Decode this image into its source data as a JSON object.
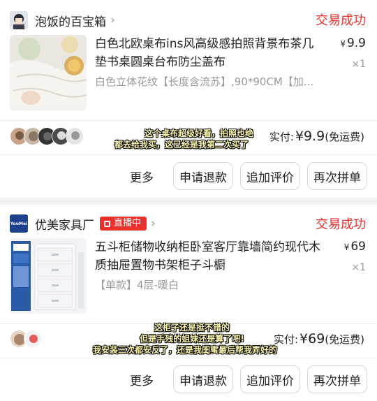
{
  "orders": [
    {
      "shop_name": "泡饭的百宝箱",
      "status": "交易成功",
      "title": "白色北欧桌布ins风高级感拍照背景布茶几垫书桌圆桌台布防尘盖布",
      "sku": "白色立体花纹【长度含流苏】,90*90CM【加...",
      "currency": "¥",
      "price": "9.9",
      "qty": "×1",
      "paid_label": "实付:",
      "paid_amount": "¥9.9",
      "paid_note": "(免运费)",
      "buttons": [
        "更多",
        "申请退款",
        "追加评价",
        "再次拼单"
      ],
      "caption_lines": [
        "这个桌布超级好看，拍照也绝",
        "都去给我买，这已经是我第二次买了"
      ]
    },
    {
      "shop_name": "优美家具厂",
      "shop_logo_text": "YouMei",
      "live_badge": "直播中",
      "status": "交易成功",
      "title": "五斗柜储物收纳柜卧室客厅靠墙简约现代木质抽屉置物书架柜子斗橱",
      "sku": "【单款】4层-暖白",
      "currency": "¥",
      "price": "69",
      "qty": "×1",
      "paid_label": "实付:",
      "paid_amount": "¥69",
      "paid_note": "(免运费)",
      "buttons": [
        "更多",
        "申请退款",
        "追加评价",
        "再次拼单"
      ],
      "caption_lines": [
        "这柜子还是挺不错的",
        "但是手残的姐妹还是算了吧!",
        "我安装三次都安反了，还是我闺蜜最后帮我弄好的"
      ]
    }
  ]
}
